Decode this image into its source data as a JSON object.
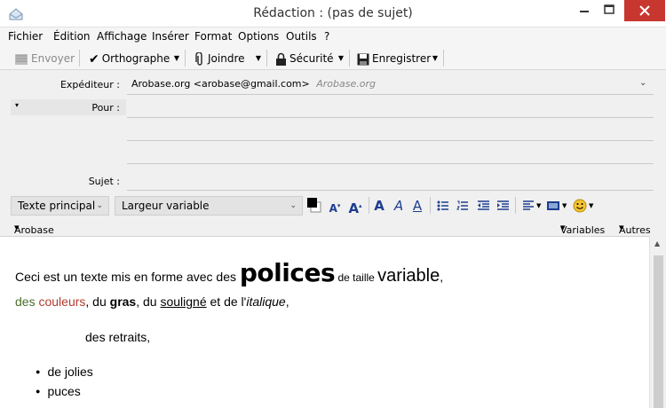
{
  "window": {
    "title": "Rédaction : (pas de sujet)"
  },
  "menu": {
    "items": [
      {
        "label": "Fichier"
      },
      {
        "label": "Édition"
      },
      {
        "label": "Affichage"
      },
      {
        "label": "Insérer"
      },
      {
        "label": "Format"
      },
      {
        "label": "Options"
      },
      {
        "label": "Outils"
      },
      {
        "label": "?"
      }
    ]
  },
  "toolbar": {
    "send_label": "Envoyer",
    "spell_label": "Orthographe",
    "attach_label": "Joindre",
    "security_label": "Sécurité",
    "save_label": "Enregistrer"
  },
  "header": {
    "from_label": "Expéditeur :",
    "from_value": "Arobase.org <arobase@gmail.com>",
    "from_account": "Arobase.org",
    "to_label": "Pour :",
    "subject_label": "Sujet :"
  },
  "format_toolbar": {
    "paragraph_select": "Texte principal",
    "font_select": "Largeur variable"
  },
  "bar": {
    "signature": "Arobase",
    "variables": "Variables",
    "others": "Autres"
  },
  "body": {
    "line1_a": "Ceci est un texte mis en forme avec des ",
    "line1_polices": "polices",
    "line1_b": " de taille ",
    "line1_variable": "variable",
    "line1_c": ",",
    "line2_des": "des ",
    "line2_couleurs": "couleurs",
    "line2_a": ", du ",
    "line2_gras": "gras",
    "line2_b": ", du ",
    "line2_souligne": "souligné",
    "line2_c": " et de l'",
    "line2_italique": "italique",
    "line2_d": ",",
    "line3": "des retraits,",
    "bullets": [
      "de jolies",
      "puces"
    ]
  },
  "colors": {
    "close_button": "#c7372f",
    "text_red": "#b03a2e",
    "text_green": "#4b6e2b",
    "format_icons": "#1d3d8f"
  }
}
